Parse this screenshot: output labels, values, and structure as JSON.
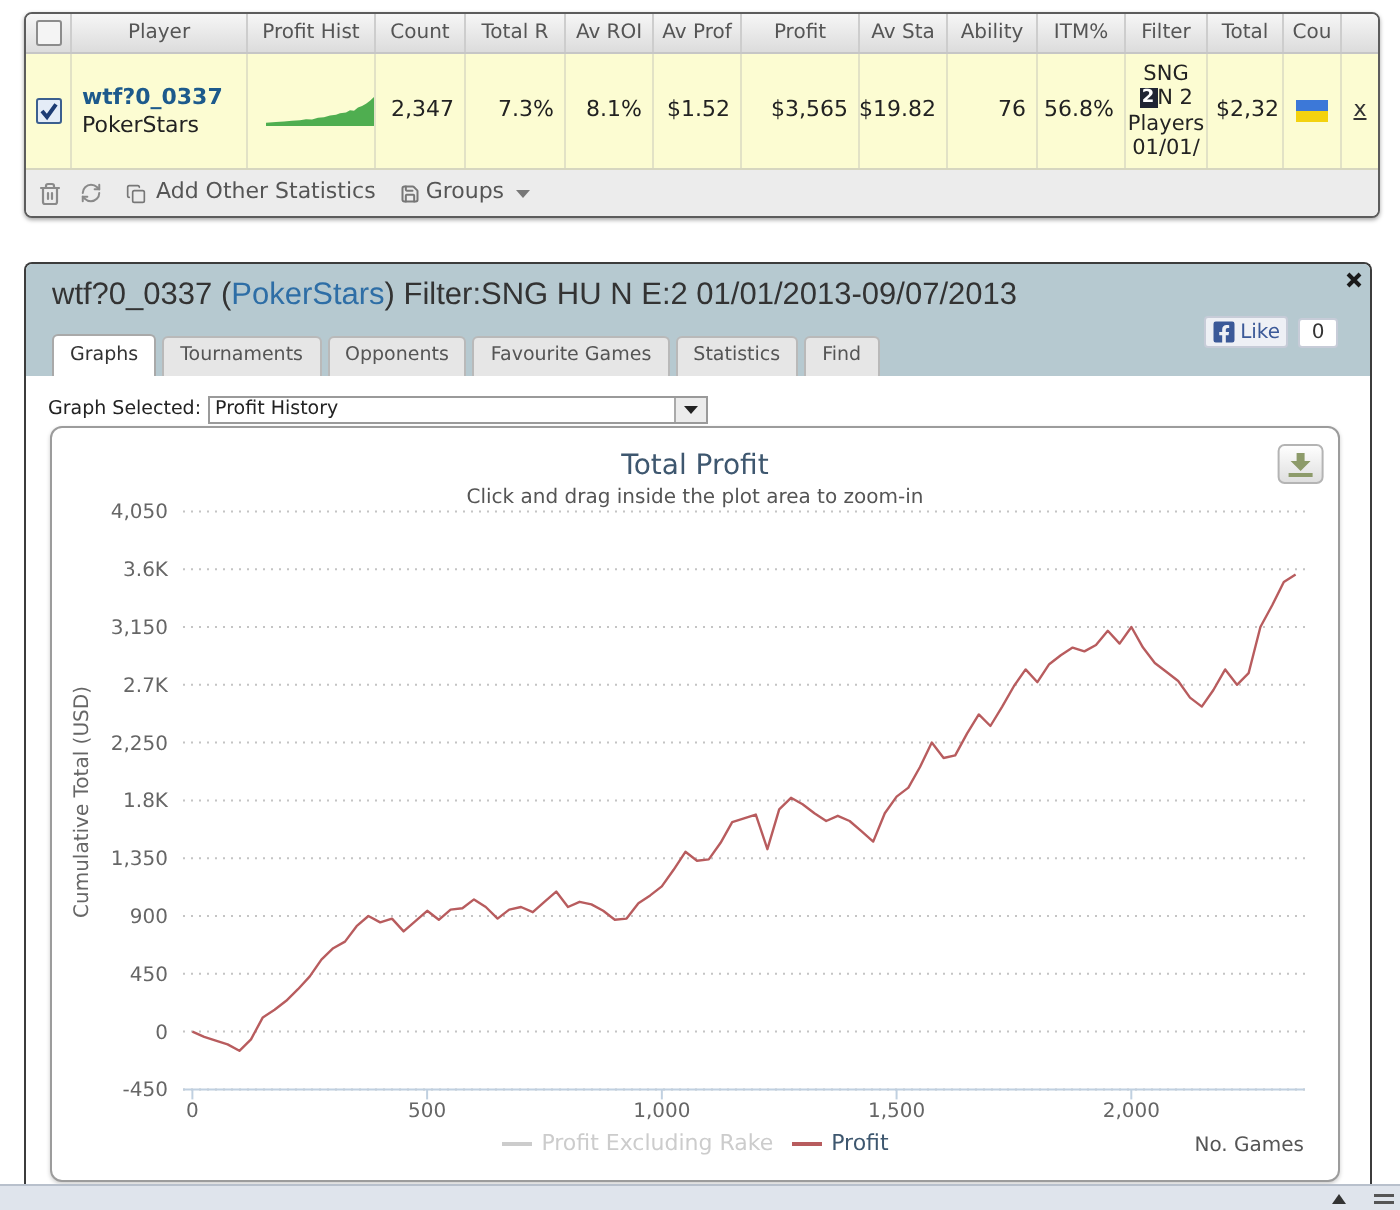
{
  "stats_table": {
    "select_all": {
      "checked": false
    },
    "columns": [
      "Player",
      "Profit Hist",
      "Count",
      "Total R",
      "Av ROI",
      "Av Prof",
      "Profit",
      "Av Sta",
      "Ability",
      "ITM%",
      "Filter",
      "Total",
      "Cou"
    ],
    "rows": [
      {
        "checked": true,
        "player": "wtf?0_0337",
        "site": "PokerStars",
        "values": [
          "2,347",
          "7.3%",
          "8.1%",
          "$1.52",
          "$3,565",
          "$19.82",
          "76",
          "56.8%"
        ],
        "filter": [
          {
            "text": "SNG"
          },
          {
            "badge": "2",
            "text": "N 2"
          },
          {
            "text": "Players"
          },
          {
            "text": "01/01/"
          }
        ],
        "total": "$2,32",
        "remove": "x"
      }
    ],
    "toolbar": {
      "add_statistics": "Add Other Statistics",
      "groups": "Groups"
    }
  },
  "player_panel": {
    "title": {
      "before": "wtf?0_0337 (",
      "site": "PokerStars",
      "after": ") Filter:SNG HU N E:2 01/01/2013-09/07/2013"
    },
    "like": {
      "label": "Like",
      "count": "0"
    },
    "tabs": [
      {
        "label": "Graphs",
        "selected": true
      },
      {
        "label": "Tournaments",
        "selected": false
      },
      {
        "label": "Opponents",
        "selected": false
      },
      {
        "label": "Favourite Games",
        "selected": false
      },
      {
        "label": "Statistics",
        "selected": false
      },
      {
        "label": "Find",
        "selected": false
      }
    ],
    "graph_select": {
      "label": "Graph Selected:",
      "value": "Profit History"
    },
    "graph": {
      "subtitle": "Click and drag inside the plot area to zoom-in",
      "chart_data": {
        "type": "line",
        "title": "Total Profit",
        "xlabel": "No. Games",
        "ylabel": "Cumulative Total (USD)",
        "grid": true,
        "x": [
          0,
          25,
          50,
          75,
          100,
          125,
          150,
          175,
          200,
          225,
          250,
          275,
          300,
          325,
          350,
          375,
          400,
          425,
          450,
          475,
          500,
          525,
          550,
          575,
          600,
          625,
          650,
          675,
          700,
          725,
          750,
          775,
          800,
          825,
          850,
          875,
          900,
          925,
          950,
          975,
          1000,
          1025,
          1050,
          1075,
          1100,
          1125,
          1150,
          1175,
          1200,
          1225,
          1250,
          1275,
          1300,
          1325,
          1350,
          1375,
          1400,
          1425,
          1450,
          1475,
          1500,
          1525,
          1550,
          1575,
          1600,
          1625,
          1650,
          1675,
          1700,
          1725,
          1750,
          1775,
          1800,
          1825,
          1850,
          1875,
          1900,
          1925,
          1950,
          1975,
          2000,
          2025,
          2050,
          2075,
          2100,
          2125,
          2150,
          2175,
          2200,
          2225,
          2250,
          2275,
          2300,
          2325,
          2350
        ],
        "series": [
          {
            "name": "Profit Excluding Rake",
            "values": [
              null,
              null,
              null,
              null,
              null,
              null,
              null,
              null,
              null,
              null,
              null,
              null,
              null,
              null,
              null,
              null,
              null,
              null,
              null,
              null,
              null,
              null,
              null,
              null,
              null,
              null,
              null,
              null,
              null,
              null,
              null,
              null,
              null,
              null,
              null,
              null,
              null,
              null,
              null,
              null,
              null,
              null,
              null,
              null,
              null,
              null,
              null,
              null,
              null,
              null,
              null,
              null,
              null,
              null,
              null,
              null,
              null,
              null,
              null,
              null,
              null,
              null,
              null,
              null,
              null,
              null,
              null,
              null,
              null,
              null,
              null,
              null,
              null,
              null,
              null,
              null,
              null,
              null,
              null,
              null,
              null,
              null,
              null,
              null,
              null,
              null,
              null,
              null,
              null,
              null,
              null,
              null,
              null,
              null,
              null
            ]
          },
          {
            "name": "Profit",
            "color": "#b85c5e",
            "values": [
              0,
              -40,
              -70,
              -100,
              -150,
              -60,
              110,
              170,
              240,
              330,
              430,
              560,
              650,
              700,
              820,
              900,
              850,
              880,
              780,
              860,
              940,
              870,
              950,
              960,
              1030,
              970,
              880,
              950,
              970,
              930,
              1010,
              1090,
              970,
              1010,
              990,
              940,
              870,
              880,
              1000,
              1060,
              1130,
              1260,
              1400,
              1330,
              1340,
              1470,
              1630,
              1660,
              1690,
              1420,
              1730,
              1820,
              1770,
              1700,
              1640,
              1680,
              1640,
              1560,
              1480,
              1700,
              1830,
              1900,
              2060,
              2250,
              2130,
              2150,
              2320,
              2470,
              2380,
              2530,
              2690,
              2820,
              2720,
              2860,
              2930,
              2990,
              2960,
              3010,
              3120,
              3020,
              3150,
              2990,
              2870,
              2800,
              2730,
              2600,
              2530,
              2660,
              2820,
              2700,
              2790,
              3150,
              3320,
              3500,
              3560
            ]
          }
        ],
        "xlim": [
          -20,
          2370
        ],
        "ylim": [
          -450,
          4050
        ],
        "xticks": [
          0,
          {
            "value": 500,
            "label": "500"
          },
          {
            "value": 1000,
            "label": "1,000"
          },
          {
            "value": 1500,
            "label": "1,500"
          },
          {
            "value": 2000,
            "label": "2,000"
          }
        ],
        "yticks": [
          -450,
          0,
          450,
          900,
          {
            "value": 1350,
            "label": "1,350"
          },
          {
            "value": 1800,
            "label": "1.8K"
          },
          {
            "value": 2250,
            "label": "2,250"
          },
          {
            "value": 2700,
            "label": "2.7K"
          },
          {
            "value": 3150,
            "label": "3,150"
          },
          {
            "value": 3600,
            "label": "3.6K"
          },
          {
            "value": 4050,
            "label": "4,050"
          }
        ]
      }
    }
  }
}
